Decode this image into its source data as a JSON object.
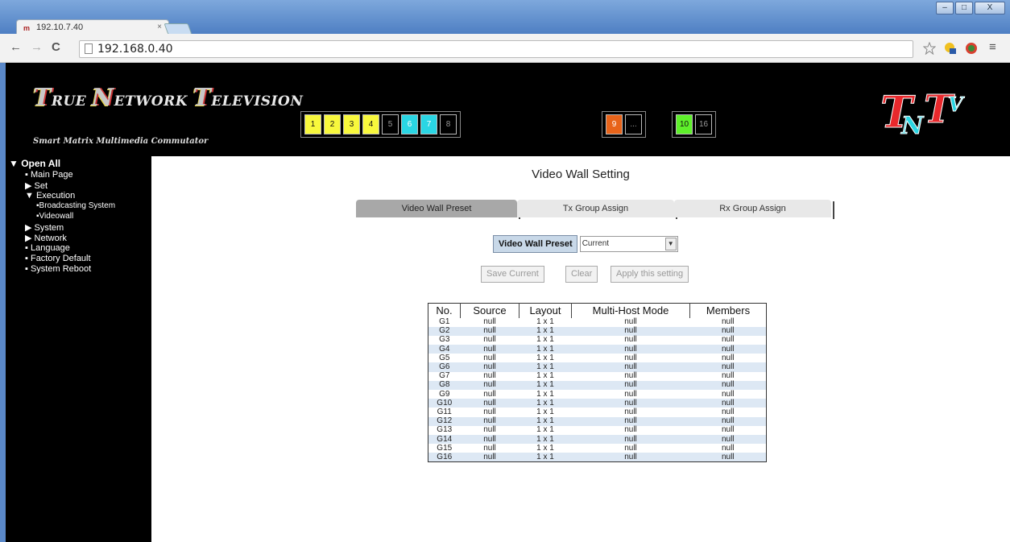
{
  "browser": {
    "tab_title": "192.10.7.40",
    "tab_close": "×",
    "url": "192.168.0.40"
  },
  "banner": {
    "logo_words": [
      {
        "cap": "T",
        "rest": "RUE"
      },
      {
        "cap": "N",
        "rest": "ETWORK"
      },
      {
        "cap": "T",
        "rest": "ELEVISION"
      }
    ],
    "subtitle": "Smart Matrix Multimedia Commutator",
    "channels_a": [
      {
        "label": "1",
        "color": "y"
      },
      {
        "label": "2",
        "color": "y"
      },
      {
        "label": "3",
        "color": "y"
      },
      {
        "label": "4",
        "color": "y"
      },
      {
        "label": "5",
        "color": "k"
      },
      {
        "label": "6",
        "color": "c"
      },
      {
        "label": "7",
        "color": "c"
      },
      {
        "label": "8",
        "color": "k"
      }
    ],
    "channels_b": [
      {
        "label": "9",
        "color": "o"
      },
      {
        "label": "...",
        "color": "k"
      }
    ],
    "channels_c": [
      {
        "label": "10",
        "color": "g"
      },
      {
        "label": "16",
        "color": "k"
      }
    ],
    "brand_colors": {
      "red": "#e8282c",
      "cyan": "#2ad6e4",
      "green": "#5ef02a",
      "yellow": "#f8f83c",
      "orange": "#e8641a"
    }
  },
  "sidebar": {
    "root": "Open All",
    "items": [
      {
        "label": "Main Page",
        "marker": "▪"
      },
      {
        "label": "Set",
        "marker": "▶"
      },
      {
        "label": "Execution",
        "marker": "▼"
      },
      {
        "label": "Broadcasting System",
        "marker": "▪"
      },
      {
        "label": "Videowall",
        "marker": "▪"
      },
      {
        "label": "System",
        "marker": "▶"
      },
      {
        "label": "Network",
        "marker": "▶"
      },
      {
        "label": "Language",
        "marker": "▪"
      },
      {
        "label": "Factory Default",
        "marker": "▪"
      },
      {
        "label": "System Reboot",
        "marker": "▪"
      }
    ]
  },
  "main": {
    "title": "Video Wall Setting",
    "tabs": [
      "Video Wall Preset",
      "Tx Group Assign",
      "Rx Group Assign"
    ],
    "preset_label": "Video Wall Preset",
    "preset_value": "Current",
    "buttons": [
      "Save Current",
      "Clear",
      "Apply this setting"
    ],
    "table": {
      "headers": [
        "No.",
        "Source",
        "Layout",
        "Multi-Host Mode",
        "Members"
      ],
      "rows": [
        [
          "G1",
          "null",
          "1 x 1",
          "null",
          "null"
        ],
        [
          "G2",
          "null",
          "1 x 1",
          "null",
          "null"
        ],
        [
          "G3",
          "null",
          "1 x 1",
          "null",
          "null"
        ],
        [
          "G4",
          "null",
          "1 x 1",
          "null",
          "null"
        ],
        [
          "G5",
          "null",
          "1 x 1",
          "null",
          "null"
        ],
        [
          "G6",
          "null",
          "1 x 1",
          "null",
          "null"
        ],
        [
          "G7",
          "null",
          "1 x 1",
          "null",
          "null"
        ],
        [
          "G8",
          "null",
          "1 x 1",
          "null",
          "null"
        ],
        [
          "G9",
          "null",
          "1 x 1",
          "null",
          "null"
        ],
        [
          "G10",
          "null",
          "1 x 1",
          "null",
          "null"
        ],
        [
          "G11",
          "null",
          "1 x 1",
          "null",
          "null"
        ],
        [
          "G12",
          "null",
          "1 x 1",
          "null",
          "null"
        ],
        [
          "G13",
          "null",
          "1 x 1",
          "null",
          "null"
        ],
        [
          "G14",
          "null",
          "1 x 1",
          "null",
          "null"
        ],
        [
          "G15",
          "null",
          "1 x 1",
          "null",
          "null"
        ],
        [
          "G16",
          "null",
          "1 x 1",
          "null",
          "null"
        ]
      ]
    }
  }
}
